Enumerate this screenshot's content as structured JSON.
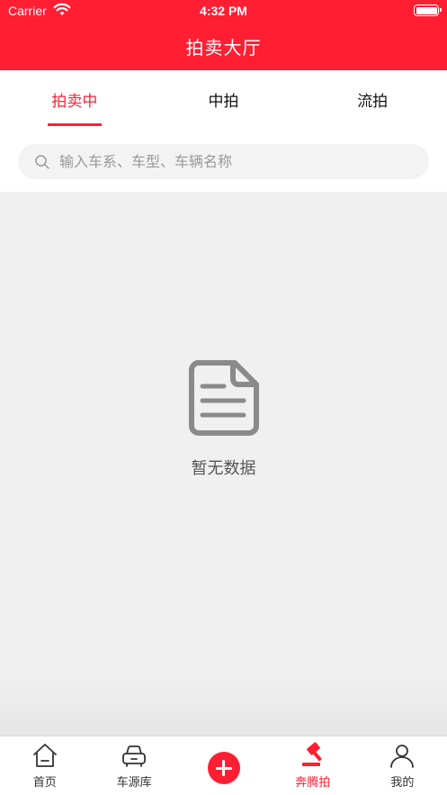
{
  "status_bar": {
    "carrier": "Carrier",
    "time": "4:32 PM"
  },
  "header": {
    "title": "拍卖大厅"
  },
  "tabs": [
    {
      "label": "拍卖中",
      "active": true
    },
    {
      "label": "中拍",
      "active": false
    },
    {
      "label": "流拍",
      "active": false
    }
  ],
  "search": {
    "placeholder": "输入车系、车型、车辆名称",
    "value": ""
  },
  "empty_state": {
    "icon": "document-icon",
    "message": "暂无数据"
  },
  "bottom_nav": [
    {
      "label": "首页",
      "icon": "home-icon",
      "active": false
    },
    {
      "label": "车源库",
      "icon": "car-icon",
      "active": false
    },
    {
      "label": "",
      "icon": "plus-icon",
      "active": false
    },
    {
      "label": "奔腾拍",
      "icon": "gavel-icon",
      "active": true
    },
    {
      "label": "我的",
      "icon": "user-icon",
      "active": false
    }
  ],
  "colors": {
    "brand_red": "#ff1e32",
    "background": "#f0f0f0"
  }
}
